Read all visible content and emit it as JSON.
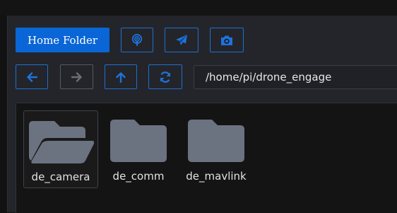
{
  "toolbar": {
    "home_label": "Home Folder",
    "icons": [
      "podcast-icon",
      "paper-plane-icon",
      "camera-icon"
    ]
  },
  "nav": {
    "back_icon": "arrow-left-icon",
    "forward_icon": "arrow-right-icon",
    "up_icon": "arrow-up-icon",
    "refresh_icon": "refresh-icon"
  },
  "path": {
    "value": "/home/pi/drone_engage"
  },
  "files": [
    {
      "name": "de_camera",
      "type": "folder",
      "selected": true
    },
    {
      "name": "de_comm",
      "type": "folder",
      "selected": false
    },
    {
      "name": "de_mavlink",
      "type": "folder",
      "selected": false
    }
  ],
  "colors": {
    "accent": "#0a66d6",
    "folder": "#6b7280",
    "background": "#121212"
  }
}
